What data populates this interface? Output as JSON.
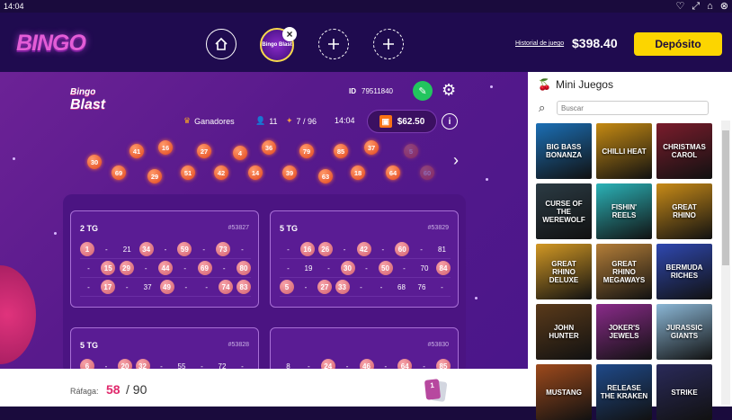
{
  "status": {
    "time": "14:04"
  },
  "header": {
    "logo": "BINGO",
    "game_thumb": "Bingo Blast",
    "history": "Historial de juego",
    "balance": "$398.40",
    "deposit": "Depósito"
  },
  "game": {
    "logo_top": "Bingo",
    "logo_bottom": "Blast",
    "id_label": "ID",
    "id_value": "79511840",
    "winners": "Ganadores",
    "players": "11",
    "tickets": "7 / 96",
    "time": "14:04",
    "prize": "$62.50"
  },
  "balls": [
    {
      "n": "30",
      "f": false
    },
    {
      "n": "41",
      "f": false
    },
    {
      "n": "16",
      "f": false
    },
    {
      "n": "27",
      "f": false
    },
    {
      "n": "4",
      "f": false
    },
    {
      "n": "36",
      "f": false
    },
    {
      "n": "79",
      "f": false
    },
    {
      "n": "85",
      "f": false
    },
    {
      "n": "37",
      "f": false
    },
    {
      "n": "5",
      "f": true
    },
    {
      "n": "69",
      "f": false
    },
    {
      "n": "29",
      "f": false
    },
    {
      "n": "51",
      "f": false
    },
    {
      "n": "42",
      "f": false
    },
    {
      "n": "14",
      "f": false
    },
    {
      "n": "39",
      "f": false
    },
    {
      "n": "63",
      "f": false
    },
    {
      "n": "18",
      "f": false
    },
    {
      "n": "64",
      "f": false
    },
    {
      "n": "60",
      "f": true
    }
  ],
  "cards": [
    {
      "title": "2 TG",
      "id": "#53827",
      "rows": [
        [
          "1",
          "-",
          "21",
          "34",
          "-",
          "59",
          "-",
          "73",
          "-"
        ],
        [
          "-",
          "15",
          "29",
          "-",
          "44",
          "-",
          "69",
          "-",
          "80"
        ],
        [
          "-",
          "17",
          "-",
          "37",
          "49",
          "-",
          "-",
          "74",
          "83"
        ]
      ],
      "marks": [
        "1",
        "34",
        "59",
        "73",
        "15",
        "29",
        "44",
        "69",
        "80",
        "17",
        "49",
        "74",
        "83"
      ]
    },
    {
      "title": "5 TG",
      "id": "#53829",
      "rows": [
        [
          "-",
          "16",
          "26",
          "-",
          "42",
          "-",
          "60",
          "-",
          "81"
        ],
        [
          "-",
          "19",
          "-",
          "30",
          "-",
          "50",
          "-",
          "70",
          "84"
        ],
        [
          "5",
          "-",
          "27",
          "33",
          "-",
          "-",
          "68",
          "76",
          "-"
        ]
      ],
      "marks": [
        "16",
        "26",
        "42",
        "60",
        "30",
        "50",
        "84",
        "5",
        "27",
        "33"
      ]
    },
    {
      "title": "5 TG",
      "id": "#53828",
      "rows": [
        [
          "6",
          "-",
          "20",
          "32",
          "-",
          "55",
          "-",
          "72",
          "-"
        ]
      ],
      "marks": [
        "6",
        "20",
        "32"
      ]
    },
    {
      "title": "",
      "id": "#53830",
      "rows": [
        [
          "8",
          "-",
          "24",
          "-",
          "46",
          "-",
          "64",
          "-",
          "85"
        ]
      ],
      "marks": [
        "24",
        "46",
        "64",
        "85"
      ]
    }
  ],
  "footer": {
    "rafaga_label": "Ráfaga:",
    "rafaga_value": "58",
    "rafaga_sep": "/",
    "rafaga_total": "90",
    "card_count": "1"
  },
  "sidebar": {
    "title": "Mini Juegos",
    "search_placeholder": "Buscar",
    "tiles": [
      {
        "name": "BIG BASS BONANZA",
        "color": "#1b6fb5"
      },
      {
        "name": "CHILLI HEAT",
        "color": "#c58a12"
      },
      {
        "name": "CHRISTMAS CAROL",
        "color": "#7a1c2c"
      },
      {
        "name": "CURSE OF THE WEREWOLF",
        "color": "#2b3b44"
      },
      {
        "name": "FISHIN' REELS",
        "color": "#2bb3b8"
      },
      {
        "name": "GREAT RHINO",
        "color": "#c88b18"
      },
      {
        "name": "GREAT RHINO DELUXE",
        "color": "#d29824"
      },
      {
        "name": "GREAT RHINO MEGAWAYS",
        "color": "#b47e38"
      },
      {
        "name": "BERMUDA RICHES",
        "color": "#2f48b0"
      },
      {
        "name": "JOHN HUNTER",
        "color": "#5a3a1a"
      },
      {
        "name": "JOKER'S JEWELS",
        "color": "#8a2b8a"
      },
      {
        "name": "JURASSIC GIANTS",
        "color": "#8bb7d6"
      },
      {
        "name": "MUSTANG",
        "color": "#9e4a1c"
      },
      {
        "name": "RELEASE THE KRAKEN",
        "color": "#1f4a8a"
      },
      {
        "name": "STRIKE",
        "color": "#2a2a5a"
      }
    ]
  }
}
